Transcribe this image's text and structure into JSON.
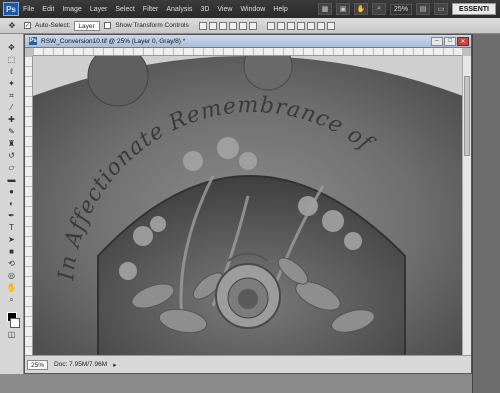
{
  "app": {
    "logo": "Ps"
  },
  "menu": {
    "items": [
      "File",
      "Edit",
      "Image",
      "Layer",
      "Select",
      "Filter",
      "Analysis",
      "3D",
      "View",
      "Window",
      "Help"
    ]
  },
  "topbar": {
    "zoom": "25%",
    "workspace": "ESSENTI"
  },
  "options": {
    "auto_select_label": "Auto-Select:",
    "auto_select_value": "Layer",
    "show_transform_label": "Show Transform Controls"
  },
  "document": {
    "title": "RSW_Conversion10.tif @ 25% (Layer 0, Gray/8) *",
    "status_zoom": "25%",
    "status_info": "Doc: 7.95M/7.96M",
    "image_engraving": "In Affectionate Remembrance of",
    "image_alt": "Carved stone tablet with ferns and a rose"
  },
  "icons": {
    "move": "move-icon",
    "marquee": "marquee-icon",
    "lasso": "lasso-icon",
    "wand": "magic-wand-icon",
    "crop": "crop-icon",
    "eyedropper": "eyedropper-icon",
    "heal": "healing-brush-icon",
    "brush": "brush-icon",
    "stamp": "clone-stamp-icon",
    "history": "history-brush-icon",
    "eraser": "eraser-icon",
    "gradient": "gradient-icon",
    "blur": "blur-icon",
    "dodge": "dodge-icon",
    "pen": "pen-icon",
    "type": "type-icon",
    "path": "path-selection-icon",
    "shape": "shape-icon",
    "hand": "hand-icon",
    "zoom": "zoom-icon"
  }
}
